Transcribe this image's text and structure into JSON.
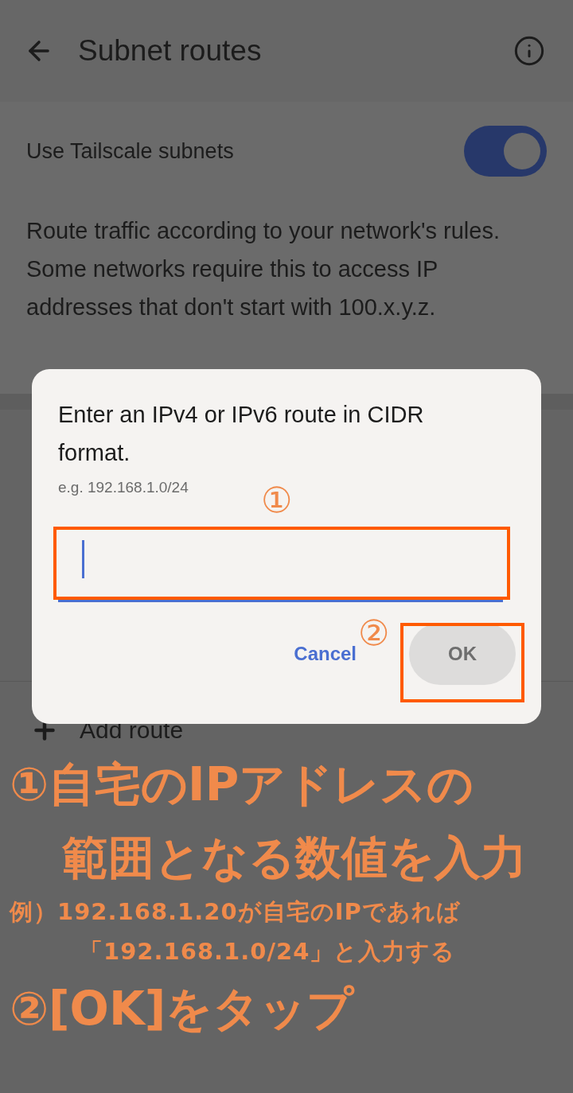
{
  "app_bar": {
    "title": "Subnet routes"
  },
  "settings": [
    {
      "label": "Use Tailscale subnets",
      "on": true
    }
  ],
  "description": "Route traffic according to your network's rules. Some networks require this to access IP addresses that don't start with 100.x.y.z.",
  "add_route": {
    "label": "Add route"
  },
  "dialog": {
    "title": "Enter an IPv4 or IPv6 route in CIDR format.",
    "hint": "e.g. 192.168.1.0/24",
    "field": {
      "focused": true
    },
    "buttons": [
      {
        "label": "Cancel",
        "disabled": false
      },
      {
        "label": "OK",
        "disabled": true
      }
    ]
  },
  "markers": [
    {
      "label": "①"
    },
    {
      "label": "②"
    }
  ],
  "notes": [
    {
      "kind": "heading",
      "text": "①自宅のIPアドレスの"
    },
    {
      "kind": "heading_cont",
      "text": "範囲となる数値を入力"
    },
    {
      "kind": "example",
      "text": "例）192.168.1.20が自宅のIPであれば"
    },
    {
      "kind": "example_cont",
      "text": "「192.168.1.0/24」と入力する"
    },
    {
      "kind": "heading",
      "text": "②[OK]をタップ"
    }
  ]
}
